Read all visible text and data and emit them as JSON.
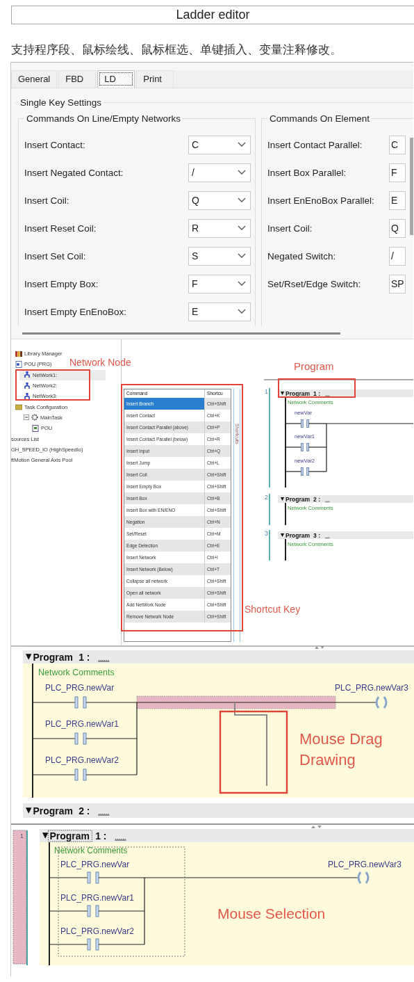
{
  "header": {
    "title": "Ladder editor"
  },
  "caption": "支持程序段、鼠标绘线、鼠标框选、单键插入、变量注释修改。",
  "settings": {
    "tabs": [
      {
        "label": "General",
        "selected": false
      },
      {
        "label": "FBD",
        "selected": false
      },
      {
        "label": "LD",
        "selected": true
      },
      {
        "label": "Print",
        "selected": false
      }
    ],
    "group_title": "Single Key Settings",
    "sections": [
      {
        "title": "Commands On Line/Empty Networks",
        "rows": [
          {
            "label": "Insert Contact:",
            "value": "C"
          },
          {
            "label": "Insert Negated Contact:",
            "value": "/"
          },
          {
            "label": "Insert Coil:",
            "value": "Q"
          },
          {
            "label": "Insert Reset Coil:",
            "value": "R"
          },
          {
            "label": "Insert Set Coil:",
            "value": "S"
          },
          {
            "label": "Insert Empty Box:",
            "value": "F"
          },
          {
            "label": "Insert Empty EnEnoBox:",
            "value": "E"
          }
        ]
      },
      {
        "title": "Commands On Element",
        "rows": [
          {
            "label": "Insert Contact Parallel:",
            "value": "C"
          },
          {
            "label": "Insert Box Parallel:",
            "value": "F"
          },
          {
            "label": "Insert EnEnoBox Parallel:",
            "value": "E"
          },
          {
            "label": "Insert Coil:",
            "value": "Q"
          },
          {
            "label": "Negated Switch:",
            "value": "/"
          },
          {
            "label": "Set/Rset/Edge Switch:",
            "value": "SP"
          }
        ]
      }
    ]
  },
  "project_tree": {
    "items": [
      {
        "label": "Library Manager",
        "kind": "library",
        "selected": false
      },
      {
        "label": "POU (PRG)",
        "kind": "pou",
        "selected": false,
        "children": [
          {
            "label": "NetWork1:",
            "kind": "network",
            "selected": true
          },
          {
            "label": "NetWork2:",
            "kind": "network",
            "selected": false
          },
          {
            "label": "NetWork3:",
            "kind": "network",
            "selected": false
          }
        ]
      },
      {
        "label": "Task Configuration",
        "kind": "taskconfig",
        "selected": false,
        "children": [
          {
            "label": "MainTask",
            "kind": "task",
            "selected": false,
            "expanded": true,
            "children": [
              {
                "label": "POU",
                "kind": "program",
                "selected": false
              }
            ]
          }
        ]
      },
      {
        "label": "sources List",
        "kind": "plain",
        "selected": false
      },
      {
        "label": "GH_SPEED_IO (HighSpeedIo)",
        "kind": "plain",
        "selected": false
      },
      {
        "label": "ftMotion General Axis Pool",
        "kind": "plain",
        "selected": false
      }
    ]
  },
  "callouts": [
    {
      "kind": "tree",
      "text": "Network Node"
    },
    {
      "kind": "program",
      "text": "Program"
    },
    {
      "kind": "shortcut",
      "text": "Shortcut Key"
    }
  ],
  "shortcuts": {
    "columns": [
      "Command",
      "Shortcu"
    ],
    "side_label": "Shortcuts",
    "rows": [
      {
        "command": "Insert Branch",
        "shortcut": "Ctrl+Shift",
        "selected": true
      },
      {
        "command": "Insert Contact",
        "shortcut": "Ctrl+K",
        "selected": false
      },
      {
        "command": "Insert Contact Parallel (above)",
        "shortcut": "Ctrl+P",
        "selected": false
      },
      {
        "command": "Insert Contact Parallel (below)",
        "shortcut": "Ctrl+R",
        "selected": false
      },
      {
        "command": "Insert Input",
        "shortcut": "Ctrl+Q",
        "selected": false
      },
      {
        "command": "Insert Jump",
        "shortcut": "Ctrl+L",
        "selected": false
      },
      {
        "command": "Insert Coil",
        "shortcut": "Ctrl+Shift",
        "selected": false
      },
      {
        "command": "Insert Empty Box",
        "shortcut": "Ctrl+Shift",
        "selected": false
      },
      {
        "command": "Insert Box",
        "shortcut": "Ctrl+B",
        "selected": false
      },
      {
        "command": "Insert Box with EN/ENO",
        "shortcut": "Ctrl+Shift",
        "selected": false
      },
      {
        "command": "Negation",
        "shortcut": "Ctrl+N",
        "selected": false
      },
      {
        "command": "Set/Reset",
        "shortcut": "Ctrl+M",
        "selected": false
      },
      {
        "command": "Edge Detection",
        "shortcut": "Ctrl+E",
        "selected": false
      },
      {
        "command": "Insert Network",
        "shortcut": "Ctrl+I",
        "selected": false
      },
      {
        "command": "Insert Network (Below)",
        "shortcut": "Ctrl+T",
        "selected": false
      },
      {
        "command": "Collapse all network",
        "shortcut": "Ctrl+Shift",
        "selected": false
      },
      {
        "command": "Open all network",
        "shortcut": "Ctrl+Shift",
        "selected": false
      },
      {
        "command": "Add NetWork Node",
        "shortcut": "Ctrl+Shift",
        "selected": false
      },
      {
        "command": "Remove Network Node",
        "shortcut": "Ctrl+Shift",
        "selected": false
      }
    ]
  },
  "networks": [
    {
      "number": "1",
      "title": "Program",
      "index": "1 :",
      "name": "....",
      "comment": "Network Comments",
      "contacts": [
        "newVar",
        "newVar1",
        "newVar2"
      ]
    },
    {
      "number": "2",
      "title": "Program",
      "index": "2 :",
      "name": "....",
      "comment": "Network Comments"
    },
    {
      "number": "3",
      "title": "Program",
      "index": "3 :",
      "name": "....",
      "comment": "Network Comments"
    }
  ],
  "drag_view": {
    "network": {
      "title": "Program",
      "index": "1 :",
      "name": "......",
      "comment": "Network Comments",
      "contacts": [
        "PLC_PRG.newVar",
        "PLC_PRG.newVar1",
        "PLC_PRG.newVar2"
      ],
      "coil": "PLC_PRG.newVar3"
    },
    "callout_lines": [
      "Mouse Drag",
      "Drawing"
    ],
    "next_network": {
      "title": "Program",
      "index": "2 :",
      "name": "......"
    }
  },
  "selection_view": {
    "line_number": "1",
    "selected": true,
    "network": {
      "title": "Program",
      "index": "1 :",
      "name": "......",
      "title_focused": true,
      "comment": "Network Comments",
      "contacts": [
        "PLC_PRG.newVar",
        "PLC_PRG.newVar1",
        "PLC_PRG.newVar2"
      ],
      "coil": "PLC_PRG.newVar3"
    },
    "callout": "Mouse Selection"
  }
}
